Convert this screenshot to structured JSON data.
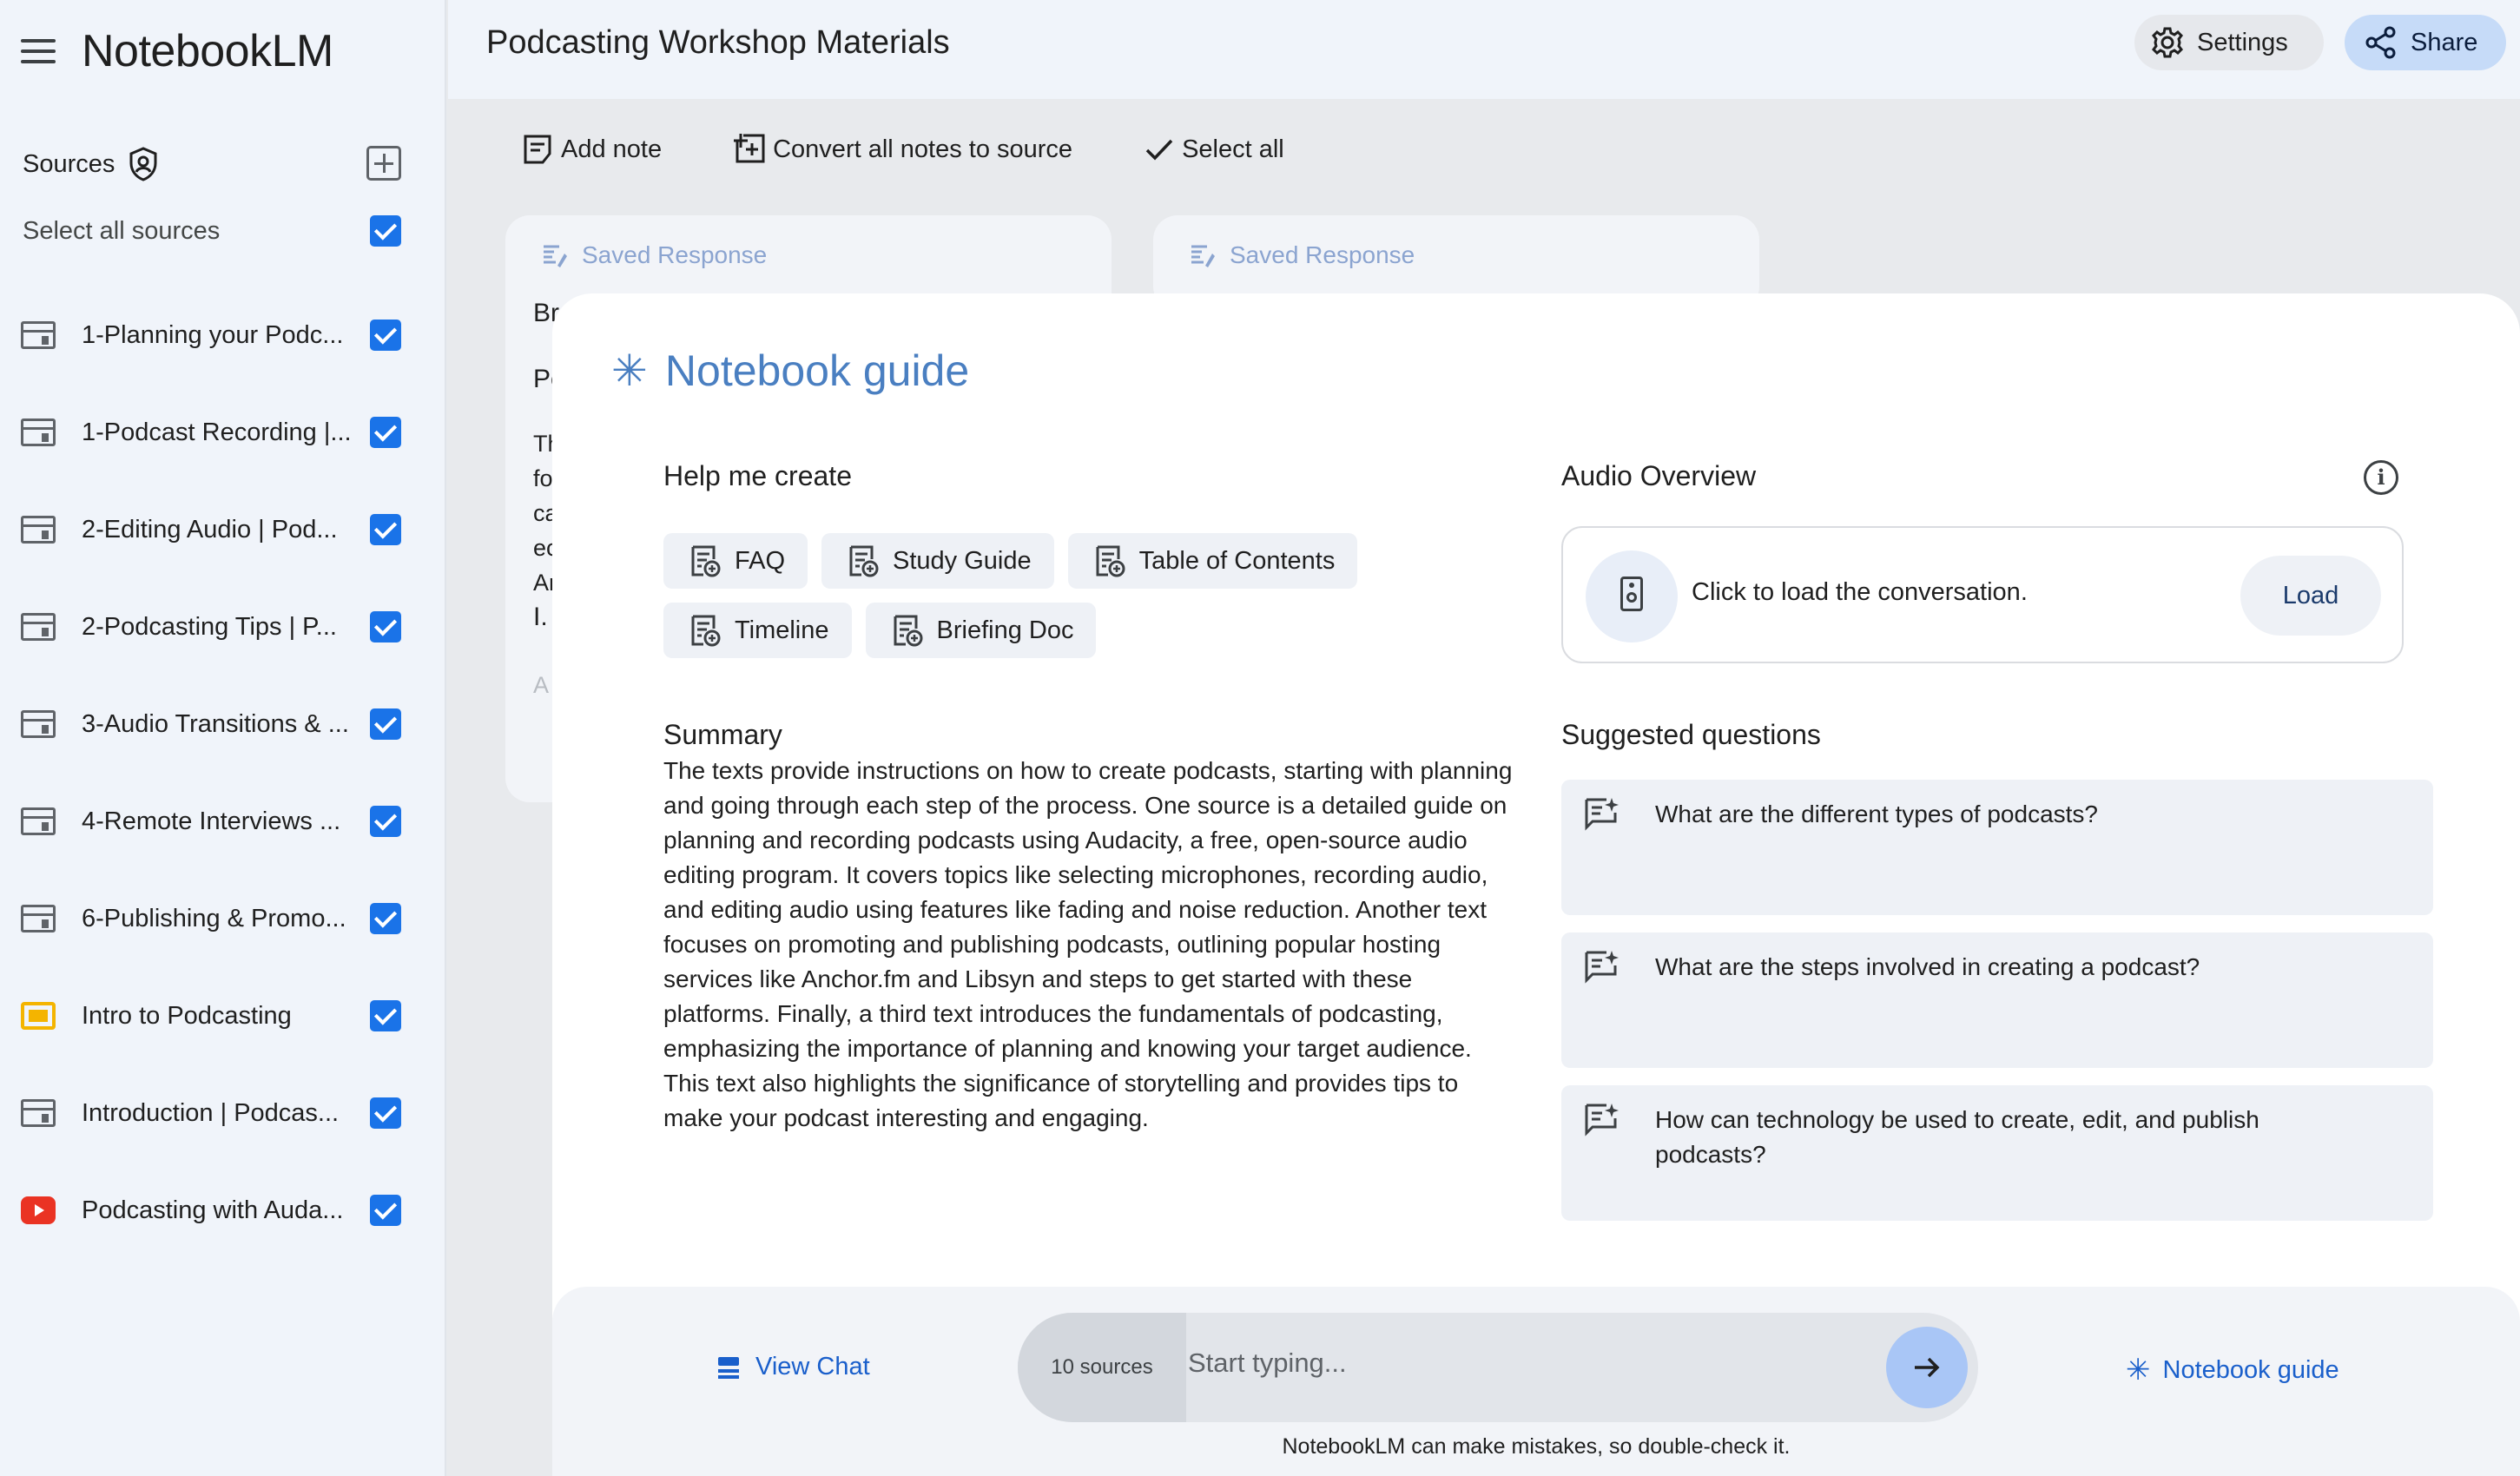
{
  "app": {
    "brand": "NotebookLM"
  },
  "sidebar": {
    "sources_title": "Sources",
    "select_all_label": "Select all sources",
    "items": [
      {
        "label": "1-Planning your Podc...",
        "icon": "doc-icon"
      },
      {
        "label": "1-Podcast Recording |...",
        "icon": "doc-icon"
      },
      {
        "label": "2-Editing Audio | Pod...",
        "icon": "doc-icon"
      },
      {
        "label": "2-Podcasting Tips | P...",
        "icon": "doc-icon"
      },
      {
        "label": "3-Audio Transitions & ...",
        "icon": "doc-icon"
      },
      {
        "label": "4-Remote Interviews ...",
        "icon": "doc-icon"
      },
      {
        "label": "6-Publishing & Promo...",
        "icon": "doc-icon"
      },
      {
        "label": "Intro to Podcasting",
        "icon": "slides-icon"
      },
      {
        "label": "Introduction | Podcas...",
        "icon": "doc-icon"
      },
      {
        "label": "Podcasting with Auda...",
        "icon": "youtube-icon"
      }
    ]
  },
  "header": {
    "title": "Podcasting Workshop Materials",
    "settings_label": "Settings",
    "share_label": "Share"
  },
  "toolbar": {
    "add_note": "Add note",
    "convert_notes": "Convert all notes to source",
    "select_all": "Select all"
  },
  "cards": [
    {
      "label": "Saved Response",
      "peek": [
        "Br",
        "Po",
        "Th",
        "fo",
        "ca",
        "ec",
        "Ar",
        "I.",
        "A"
      ]
    },
    {
      "label": "Saved Response"
    }
  ],
  "guide": {
    "title": "Notebook guide",
    "help_title": "Help me create",
    "chips": [
      "FAQ",
      "Study Guide",
      "Table of Contents",
      "Timeline",
      "Briefing Doc"
    ],
    "summary_title": "Summary",
    "summary": "The texts provide instructions on how to create podcasts, starting with planning and going through each step of the process. One source is a detailed guide on planning and recording podcasts using Audacity, a free, open-source audio editing program. It covers topics like selecting microphones, recording audio, and editing audio using features like fading and noise reduction. Another text focuses on promoting and publishing podcasts, outlining popular hosting services like Anchor.fm and Libsyn and steps to get started with these platforms. Finally, a third text introduces the fundamentals of podcasting, emphasizing the importance of planning and knowing your target audience. This text also highlights the significance of storytelling and provides tips to make your podcast interesting and engaging.",
    "audio_title": "Audio Overview",
    "info_glyph": "i",
    "audio_text": "Click to load the conversation.",
    "load_label": "Load",
    "suggested_title": "Suggested questions",
    "questions": [
      "What are the different types of podcasts?",
      "What are the steps involved in creating a podcast?",
      "How can technology be used to create, edit, and publish podcasts?"
    ]
  },
  "chat_bar": {
    "view_chat": "View Chat",
    "sources_count": "10 sources",
    "placeholder": "Start typing...",
    "notebook_guide": "Notebook guide",
    "disclaimer": "NotebookLM can make mistakes, so double-check it."
  },
  "colors": {
    "accent": "#1a73e8",
    "guide_title": "#4a7fc1",
    "share_bg": "#c6dbf8"
  }
}
